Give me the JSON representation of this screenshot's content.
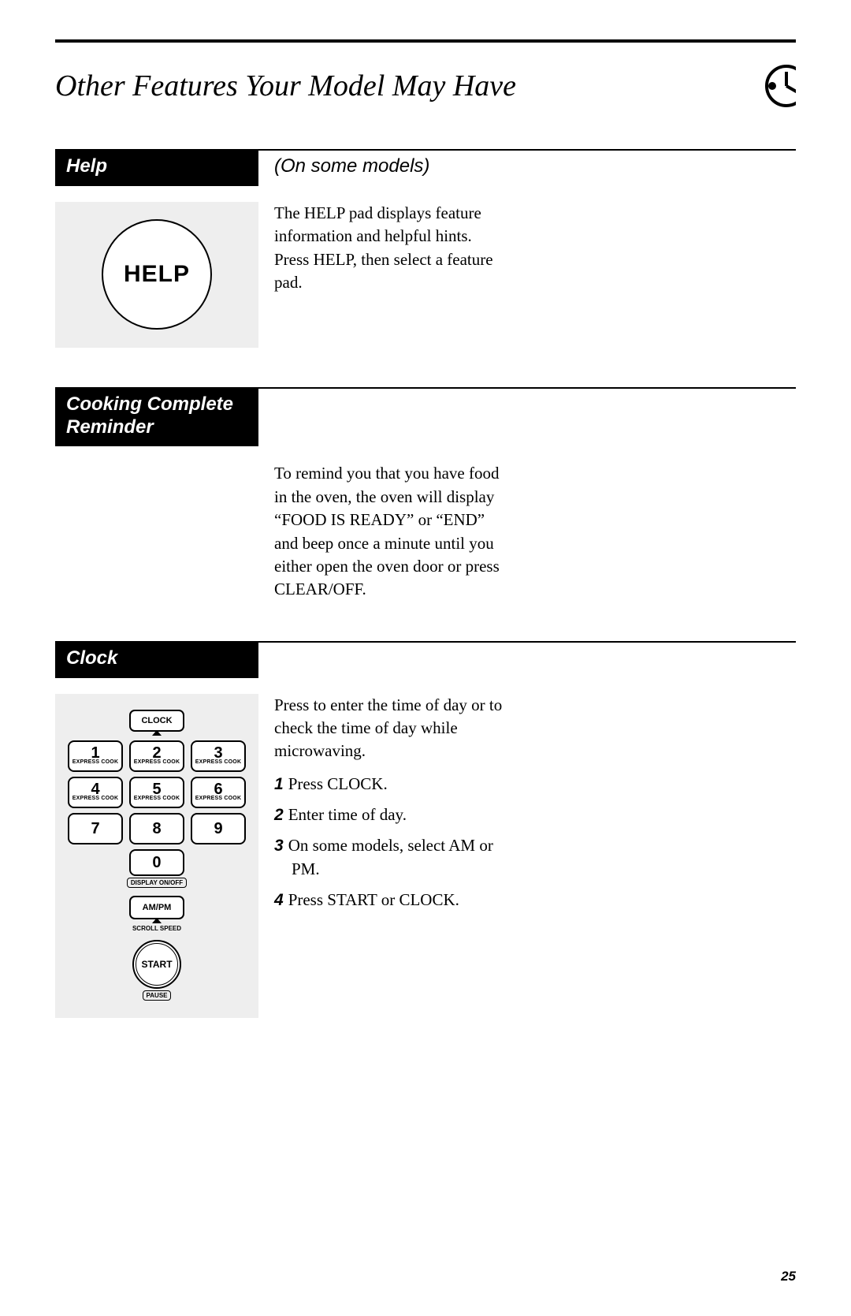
{
  "page_title": "Other Features Your Model May Have",
  "page_number": "25",
  "help_section": {
    "label": "Help",
    "subhead": "(On some models)",
    "button_text": "HELP",
    "body": "The HELP pad displays feature information and helpful hints. Press HELP, then select a feature pad."
  },
  "reminder_section": {
    "label": "Cooking Complete Reminder",
    "body": "To remind you that you have food in the oven, the oven will display “FOOD IS READY” or “END” and beep once a minute until you either open the oven door or press CLEAR/OFF."
  },
  "clock_section": {
    "label": "Clock",
    "intro": "Press to enter the time of day or to check the time of day while microwaving.",
    "steps": [
      {
        "n": "1",
        "text": "Press CLOCK."
      },
      {
        "n": "2",
        "text": "Enter time of day."
      },
      {
        "n": "3",
        "text": "On some models, select AM or PM."
      },
      {
        "n": "4",
        "text": "Press START or CLOCK."
      }
    ],
    "keypad": {
      "clock_label": "CLOCK",
      "express": "EXPRESS COOK",
      "keys": [
        "1",
        "2",
        "3",
        "4",
        "5",
        "6",
        "7",
        "8",
        "9",
        "0"
      ],
      "display_label": "DISPLAY ON/OFF",
      "ampm_label": "AM/PM",
      "scroll_label": "SCROLL SPEED",
      "start_label": "START",
      "pause_label": "PAUSE"
    }
  }
}
